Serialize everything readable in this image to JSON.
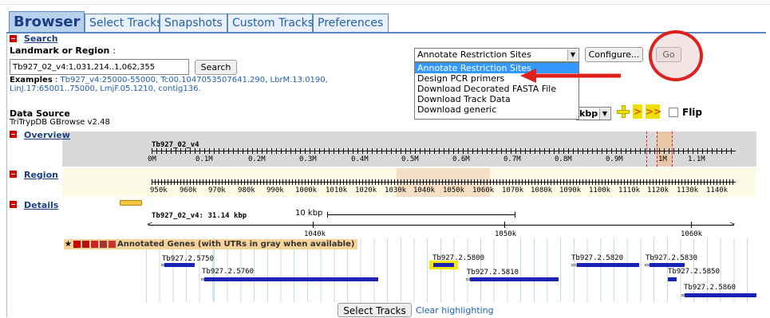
{
  "tabs": [
    {
      "label": "Browser",
      "active": true
    },
    {
      "label": "Select Tracks"
    },
    {
      "label": "Snapshots"
    },
    {
      "label": "Custom Tracks"
    },
    {
      "label": "Preferences"
    }
  ],
  "search": {
    "section_label": "Search",
    "landmark_label": "Landmark or Region",
    "landmark_value": "Tb927_02_v4:1,031,214..1,062,355",
    "search_button": "Search",
    "examples_label": "Examples",
    "examples_line1": "Tb927_v4:25000-55000, Tc00.1047053507641.290, LbrM.13.0190,",
    "examples_line2": "LinJ.17:65001..75000, LmjF.05.1210, contig136."
  },
  "data_source": {
    "label": "Data Source",
    "value": "TriTrypDB GBrowse v2.48"
  },
  "plugin": {
    "selected": "Annotate Restriction Sites",
    "configure_button": "Configure...",
    "go_button": "Go",
    "options": [
      "Annotate Restriction Sites",
      "Design PCR primers",
      "Download Decorated FASTA File",
      "Download Track Data",
      "Download generic"
    ]
  },
  "zoom": {
    "value": "kbp",
    "flip_label": "Flip"
  },
  "overview": {
    "label": "Overview",
    "chrom": "Tb927_02_v4",
    "ticks": [
      "0M",
      "0.1M",
      "0.2M",
      "0.3M",
      "0.4M",
      "0.5M",
      "0.6M",
      "0.7M",
      "0.8M",
      "0.9M",
      "1M",
      "1.1M"
    ]
  },
  "region": {
    "label": "Region",
    "ticks": [
      "950k",
      "960k",
      "970k",
      "980k",
      "990k",
      "1000k",
      "1010k",
      "1020k",
      "1030k",
      "1040k",
      "1050k",
      "1060k",
      "1070k",
      "1080k",
      "1090k",
      "1100k",
      "1110k",
      "1120k",
      "1130k",
      "1140k"
    ]
  },
  "details": {
    "label": "Details",
    "summary": "Tb927_02_v4: 31.14 kbp",
    "scale": "10 kbp",
    "ticks": [
      "1040k",
      "1050k",
      "1060k"
    ],
    "track_title": "Annotated Genes (with UTRs in gray when available)",
    "genes": [
      "Tb927.2.5750",
      "Tb927.2.5760",
      "Tb927.2.5800",
      "Tb927.2.5810",
      "Tb927.2.5820",
      "Tb927.2.5830",
      "Tb927.2.5850",
      "Tb927.2.5860"
    ]
  },
  "footer": {
    "select_tracks": "Select Tracks",
    "clear_highlighting": "Clear highlighting"
  },
  "colors": {
    "tab_active": "#b8d0ec",
    "link": "#2060b0",
    "gene": "#1a22b8",
    "annotation_red": "#e0201c",
    "highlight_yellow": "#f5e600"
  }
}
